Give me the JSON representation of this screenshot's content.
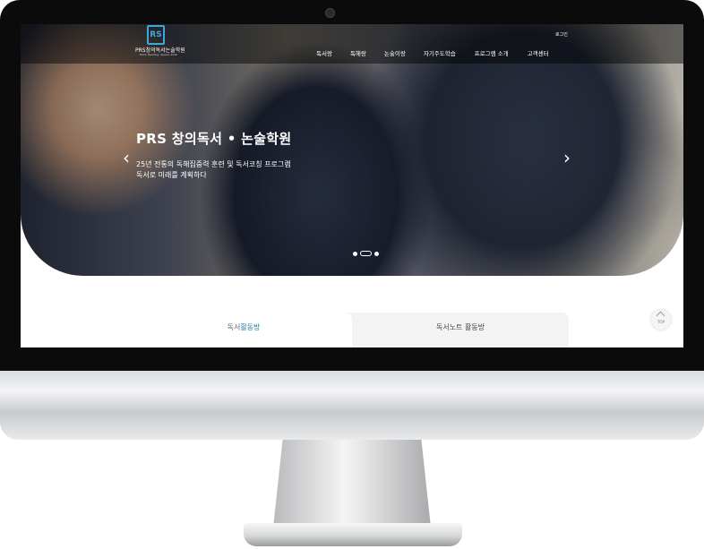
{
  "header": {
    "logo_mark": "RS",
    "logo_name": "PRS창의독서논술학원",
    "logo_sub": "Point, Reading, Speed, 2010",
    "login": "로그인",
    "nav": [
      "독서랑",
      "독해랑",
      "논술이랑",
      "자기주도학습",
      "프로그램 소개",
      "고객센터"
    ]
  },
  "hero": {
    "title": "PRS 창의독서 • 논술학원",
    "line1": "25년 전통의 독해집중력 훈련 및 독서코칭 프로그램",
    "line2": "독서로 미래를 계획하다",
    "prev_arrow": "‹",
    "next_arrow": "›"
  },
  "tabs": {
    "tab1_prefix": "독서",
    "tab1_accent": "활동방",
    "tab2": "독서노트 활동방"
  },
  "top_button": {
    "label": "TOP"
  },
  "colors": {
    "accent": "#1c7fa6",
    "logo": "#3aa9d8",
    "bezel": "#0b0b0b"
  }
}
